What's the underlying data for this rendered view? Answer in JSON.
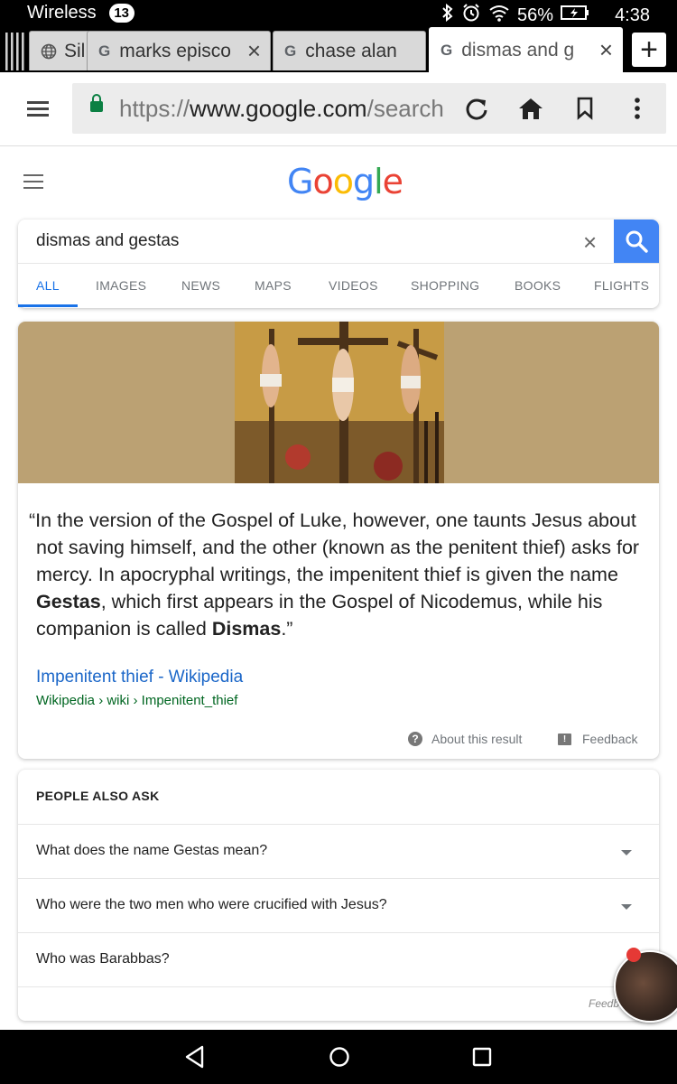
{
  "status_bar": {
    "network": "Wireless",
    "notification_count": "13",
    "battery": "56%",
    "time": "4:38"
  },
  "browser_tabs": [
    {
      "title": "Sil",
      "icon": "globe-icon"
    },
    {
      "title": "marks episco",
      "icon": "google-g-icon"
    },
    {
      "title": "chase alan",
      "icon": "google-g-icon"
    },
    {
      "title": "dismas and g",
      "icon": "google-g-icon",
      "active": true
    }
  ],
  "toolbar": {
    "url_scheme": "https://",
    "url_host": "www.google.com",
    "url_path": "/search"
  },
  "google": {
    "logo": "Google",
    "logo_colors": [
      "#4285F4",
      "#EA4335",
      "#FBBC05",
      "#4285F4",
      "#34A853",
      "#EA4335"
    ],
    "query": "dismas and gestas",
    "tabs": [
      "ALL",
      "IMAGES",
      "NEWS",
      "MAPS",
      "VIDEOS",
      "SHOPPING",
      "BOOKS",
      "FLIGHTS"
    ],
    "active_tab": "ALL"
  },
  "featured_snippet": {
    "quote_part1": "“In the version of the Gospel of Luke, however, one taunts Jesus about not saving himself, and the other (known as the penitent thief) asks for mercy. In apocryphal writings, the impenitent thief is given the name ",
    "bold1": "Gestas",
    "quote_part2": ", which first appears in the Gospel of Nicodemus, while his companion is called ",
    "bold2": "Dismas",
    "quote_part3": ".”",
    "source_title": "Impenitent thief - Wikipedia",
    "source_path": "Wikipedia › wiki › Impenitent_thief",
    "about_label": "About this result",
    "feedback_label": "Feedback"
  },
  "people_also_ask": {
    "title": "PEOPLE ALSO ASK",
    "questions": [
      "What does the name Gestas mean?",
      "Who were the two men who were crucified with Jesus?",
      "Who was Barabbas?"
    ],
    "feedback_label": "Feedb"
  }
}
